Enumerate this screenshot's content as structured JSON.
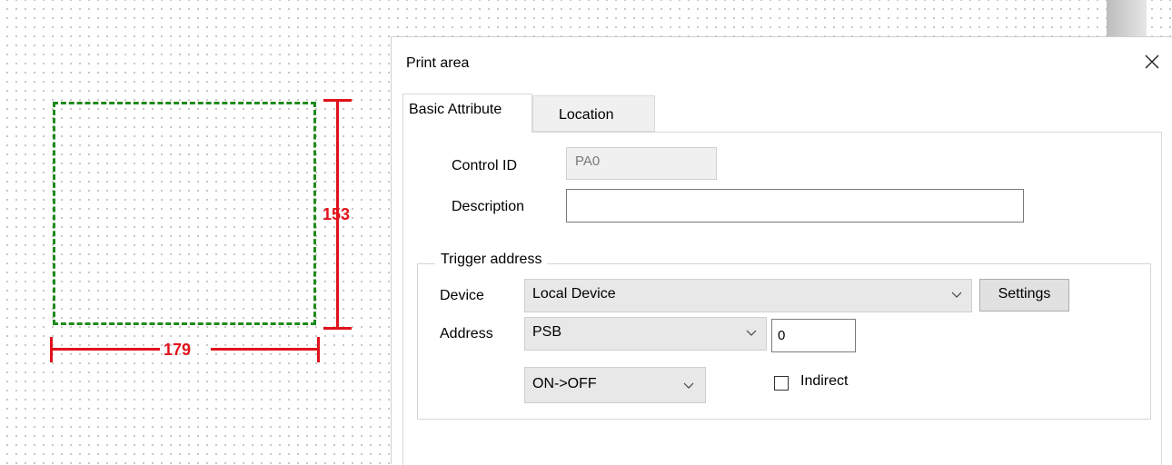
{
  "canvas": {
    "print_area_width": "179",
    "print_area_height": "153"
  },
  "dialog": {
    "title": "Print area",
    "tabs": [
      {
        "label": "Basic Attribute",
        "active": true
      },
      {
        "label": "Location",
        "active": false
      }
    ],
    "control_id": {
      "label": "Control ID",
      "value": "PA0"
    },
    "description": {
      "label": "Description",
      "value": ""
    },
    "trigger_address": {
      "legend": "Trigger address",
      "device_label": "Device",
      "device_value": "Local Device",
      "settings_button": "Settings",
      "address_label": "Address",
      "address_type": "PSB",
      "address_value": "0",
      "trigger_mode": "ON->OFF",
      "indirect_label": "Indirect",
      "indirect_checked": false
    }
  },
  "colors": {
    "dashed_frame": "#1e8a1e",
    "dimension": "#e0121b"
  }
}
